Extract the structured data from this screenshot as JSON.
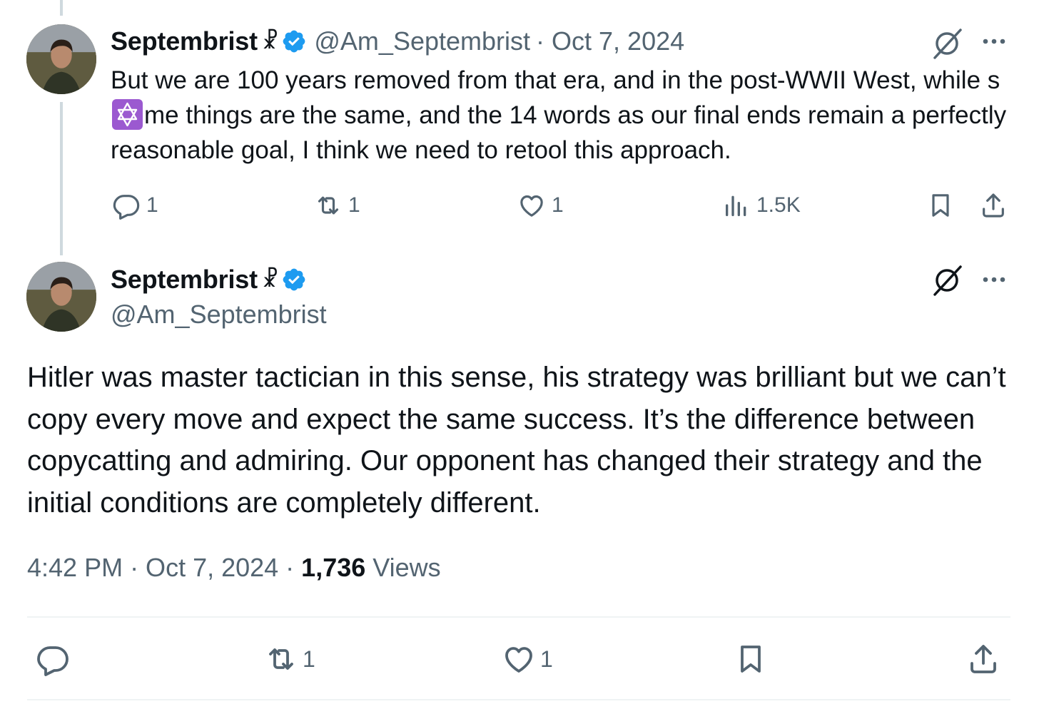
{
  "parent_tweet": {
    "author_name": "Septembrist",
    "author_symbol": "☧",
    "handle": "@Am_Septembrist",
    "date": "· Oct 7, 2024",
    "text_part1": "But we are 100 years removed from that era, and in the post-WWII West, while s",
    "text_part2": "me things are the same, and the 14 words as our final ends remain a perfectly reasonable goal, I think we need to retool this approach.",
    "replies": "1",
    "reposts": "1",
    "likes": "1",
    "views": "1.5K"
  },
  "main_tweet": {
    "author_name": "Septembrist",
    "author_symbol": "☧",
    "handle": "@Am_Septembrist",
    "text": "Hitler was master tactician in this sense, his strategy was brilliant but we can’t copy every move and expect the same success. It’s the difference between copycatting and admiring. Our opponent has changed their strategy and the initial conditions are completely different.",
    "time": "4:42 PM · Oct 7, 2024 · ",
    "views_count": "1,736",
    "views_label": " Views",
    "reposts": "1",
    "likes": "1"
  },
  "icons": {
    "verified": "verified-badge-icon",
    "grok": "grok-icon",
    "more": "more-options-icon",
    "reply": "reply-icon",
    "repost": "repost-icon",
    "like": "like-icon",
    "views": "views-icon",
    "bookmark": "bookmark-icon",
    "share": "share-icon",
    "emoji": "star-of-david-emoji"
  },
  "colors": {
    "text": "#0f1419",
    "secondary": "#536471",
    "verified": "#1d9bf0",
    "divider": "#eff3f4",
    "thread_line": "#cfd9de",
    "emoji_bg": "#9b59d0"
  }
}
